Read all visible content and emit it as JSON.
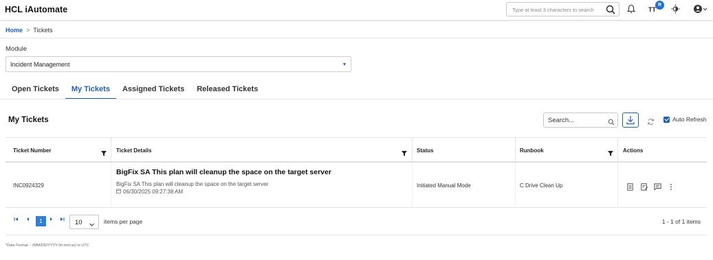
{
  "header": {
    "app_title": "HCL iAutomate",
    "search_placeholder": "Type at least 3 characters to search",
    "user_badge": "R",
    "tt_label": "TT"
  },
  "breadcrumb": {
    "home": "Home",
    "separator": ">",
    "current": "Tickets"
  },
  "module": {
    "label": "Module",
    "selected": "Incident Management"
  },
  "tabs": [
    {
      "label": "Open Tickets",
      "active": false
    },
    {
      "label": "My Tickets",
      "active": true
    },
    {
      "label": "Assigned Tickets",
      "active": false
    },
    {
      "label": "Released Tickets",
      "active": false
    }
  ],
  "card": {
    "title": "My Tickets",
    "search_placeholder": "Search...",
    "auto_refresh_label": "Auto Refresh",
    "auto_refresh_checked": true
  },
  "table": {
    "columns": [
      "Ticket Number",
      "Ticket Details",
      "Status",
      "Runbook",
      "Actions"
    ],
    "rows": [
      {
        "ticket_number": "INC0924329",
        "title": "BigFix SA This plan will cleanup the space on the target server",
        "subtitle": "BigFix SA This plan will cleanup the space on the target server",
        "date": "06/30/2025 09:27:38 AM",
        "status": "Initiated Manual Mode",
        "runbook": "C Drive Clean Up"
      }
    ]
  },
  "pager": {
    "current_page": "1",
    "page_size": "10",
    "items_per_page_label": "items per page",
    "info": "1 - 1 of 1 items"
  },
  "footnote": "*Date Format :- (MM/DD/YYYY hh:mm:ss) in UTC",
  "colors": {
    "accent": "#1f5fbf",
    "page_active": "#2f7fd8"
  }
}
